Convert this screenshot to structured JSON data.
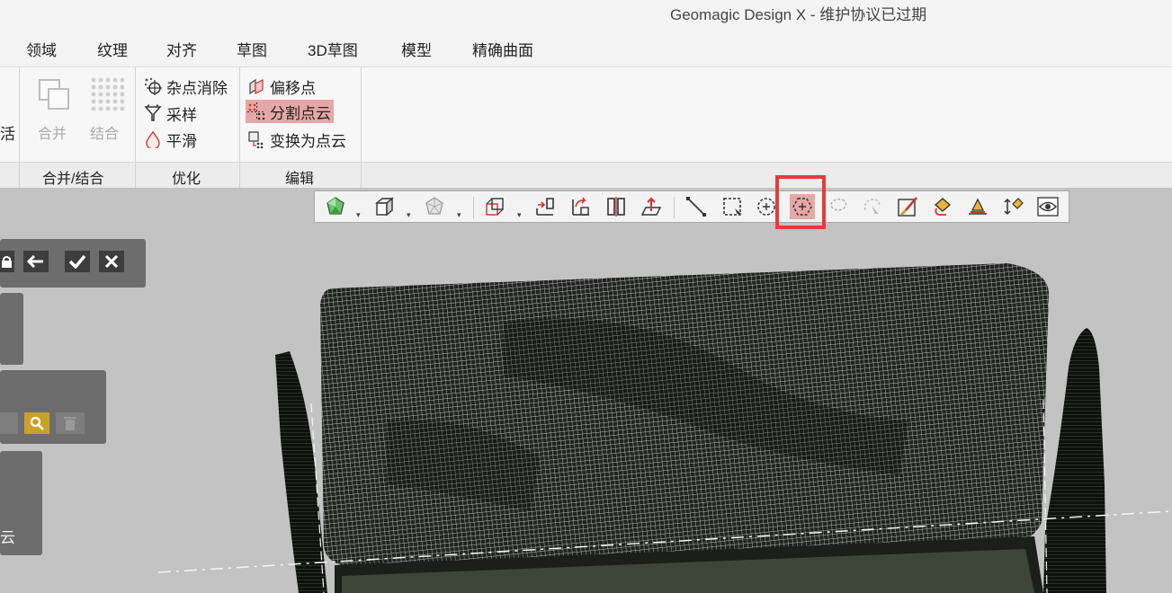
{
  "window": {
    "title": "Geomagic Design X - 维护协议已过期"
  },
  "menu": {
    "tabs": [
      "领域",
      "纹理",
      "对齐",
      "草图",
      "3D草图",
      "模型",
      "精确曲面"
    ]
  },
  "ribbon": {
    "partial_label": "活",
    "merge_group": {
      "label": "合并/结合",
      "buttons": [
        {
          "label": "合并",
          "icon": "merge-icon",
          "enabled": false
        },
        {
          "label": "结合",
          "icon": "combine-icon",
          "enabled": false
        }
      ]
    },
    "optimize_group": {
      "label": "优化",
      "buttons": [
        {
          "label": "杂点消除",
          "icon": "noise-removal-icon"
        },
        {
          "label": "采样",
          "icon": "sampling-icon"
        },
        {
          "label": "平滑",
          "icon": "smooth-icon"
        }
      ]
    },
    "edit_group": {
      "label": "编辑",
      "buttons": [
        {
          "label": "偏移点",
          "icon": "offset-points-icon"
        },
        {
          "label": "分割点云",
          "icon": "split-point-cloud-icon",
          "active": true
        },
        {
          "label": "变换为点云",
          "icon": "convert-to-point-cloud-icon"
        }
      ]
    }
  },
  "view_toolbar": {
    "buttons": [
      "display-mode-icon",
      "view-cube-icon",
      "render-mode-icon",
      "section-box-icon",
      "front-view-icon",
      "rotate-view-icon",
      "mirror-view-icon",
      "normal-view-icon",
      "line-select-icon",
      "rectangle-select-icon",
      "circle-select-icon",
      "polygon-select-icon",
      "lasso-select-icon",
      "freehand-select-icon",
      "paint-brush-icon",
      "fill-paint-icon",
      "extend-select-icon",
      "expand-shrink-icon",
      "visibility-icon"
    ],
    "selected": "polygon-select-icon",
    "highlight_color": "#e53b3b"
  },
  "left_panel": {
    "cloud_label_partial": "云"
  },
  "colors": {
    "accent_active": "#e5a7a7",
    "panel_bg": "#6d6d6d",
    "viewport_bg": "#c3c3c3",
    "search_button": "#c9a227"
  }
}
